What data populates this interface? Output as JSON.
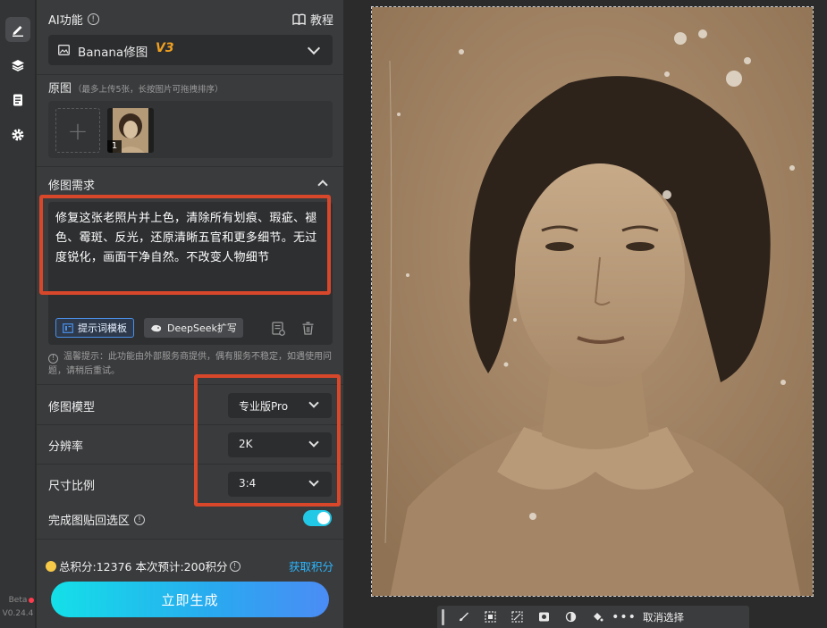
{
  "rail": {
    "items": [
      {
        "icon": "edit-icon",
        "active": true
      },
      {
        "icon": "layers-icon",
        "active": false
      },
      {
        "icon": "notebook-icon",
        "active": false
      },
      {
        "icon": "gear-icon",
        "active": false
      }
    ],
    "beta_label": "Beta",
    "version": "V0.24.4"
  },
  "header": {
    "title": "AI功能",
    "tutorial_label": "教程"
  },
  "model_select": {
    "name": "Banana修图",
    "version_badge": "V3",
    "badge_color": "#f0a020"
  },
  "original": {
    "title": "原图",
    "hint": "（最多上传5张，长按图片可拖拽排序）",
    "add_symbol": "+",
    "thumb_number": "1"
  },
  "requirement": {
    "title": "修图需求",
    "prompt": "修复这张老照片并上色，清除所有划痕、瑕疵、褪色、霉斑、反光，还原清晰五官和更多细节。无过度锐化，画面干净自然。不改变人物细节",
    "template_button": "提示词模板",
    "deepseek_button": "DeepSeek扩写"
  },
  "tip": {
    "text": "温馨提示：此功能由外部服务商提供，偶有服务不稳定，如遇使用问题，请稍后重试。"
  },
  "settings": {
    "model_label": "修图模型",
    "model_value": "专业版Pro",
    "resolution_label": "分辨率",
    "resolution_value": "2K",
    "ratio_label": "尺寸比例",
    "ratio_value": "3:4",
    "paste_back_label": "完成图贴回选区",
    "paste_back_enabled": true
  },
  "footer": {
    "points_text": "总积分:12376  本次预计:200积分",
    "get_points": "获取积分",
    "generate_button": "立即生成",
    "accent": "#2ab7ff"
  },
  "canvas_toolbar": {
    "tools": [
      "brush-icon",
      "select-subject-icon",
      "select-region-icon",
      "mask-icon",
      "contrast-icon",
      "fill-icon",
      "more-icon"
    ],
    "cancel_select": "取消选择"
  }
}
